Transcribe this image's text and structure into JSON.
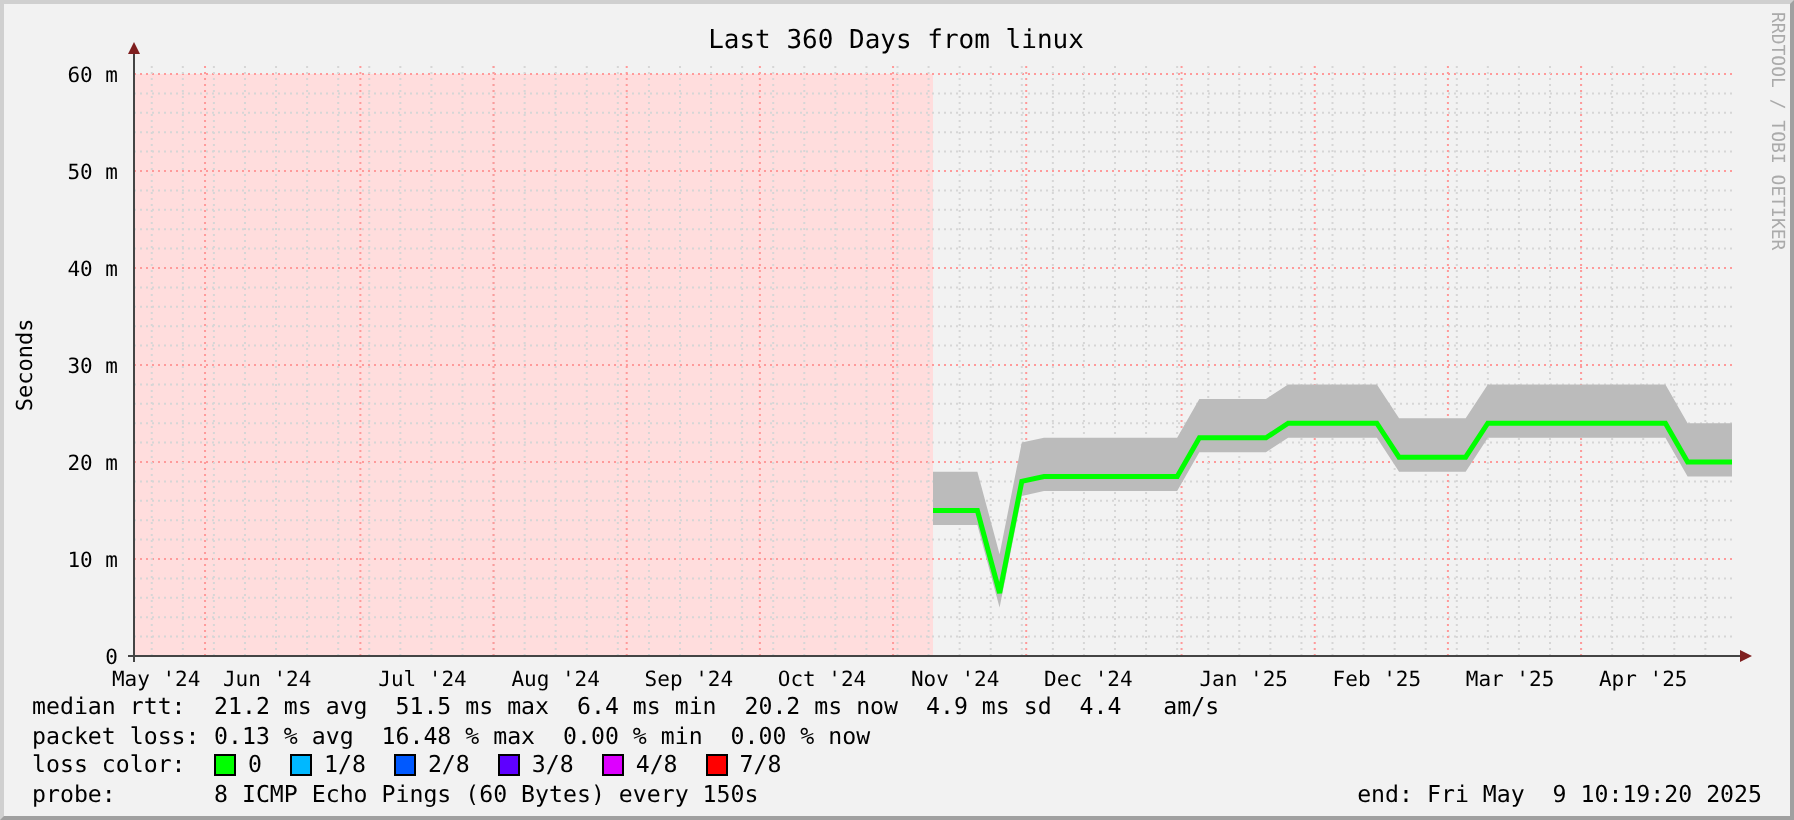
{
  "graph": {
    "watermark_text": "RRDTOOL / TOBI OETIKER",
    "chart_data": {
      "type": "line",
      "grid": true,
      "title": "Last 360 Days from linux",
      "ylabel": "Seconds",
      "ylim": [
        0,
        60
      ],
      "yticks": [
        {
          "value": 0,
          "label": "0"
        },
        {
          "value": 10,
          "label": "10 m"
        },
        {
          "value": 20,
          "label": "20 m"
        },
        {
          "value": 30,
          "label": "30 m"
        },
        {
          "value": 40,
          "label": "40 m"
        },
        {
          "value": 50,
          "label": "50 m"
        },
        {
          "value": 60,
          "label": "60 m"
        }
      ],
      "categories": [
        null,
        "May '24",
        null,
        null,
        null,
        null,
        "Jun '24",
        null,
        null,
        null,
        null,
        null,
        null,
        "Jul '24",
        null,
        null,
        null,
        null,
        null,
        "Aug '24",
        null,
        null,
        null,
        null,
        null,
        "Sep '24",
        null,
        null,
        null,
        null,
        null,
        "Oct '24",
        null,
        null,
        null,
        null,
        null,
        "Nov '24",
        null,
        null,
        null,
        null,
        null,
        "Dec '24",
        null,
        null,
        null,
        null,
        null,
        null,
        "Jan '25",
        null,
        null,
        null,
        null,
        null,
        "Feb '25",
        null,
        null,
        null,
        null,
        null,
        "Mar '25",
        null,
        null,
        null,
        null,
        null,
        "Apr '25",
        null,
        null,
        null,
        null
      ],
      "series": [
        {
          "color": "#00ff00",
          "values": [
            null,
            null,
            null,
            null,
            null,
            null,
            null,
            null,
            null,
            null,
            null,
            null,
            null,
            null,
            null,
            null,
            null,
            null,
            null,
            null,
            null,
            null,
            null,
            null,
            null,
            null,
            null,
            null,
            null,
            null,
            null,
            null,
            null,
            null,
            null,
            null,
            15,
            15,
            15,
            6.5,
            18,
            18.5,
            18.5,
            18.5,
            18.5,
            18.5,
            18.5,
            18.5,
            22.5,
            22.5,
            22.5,
            22.5,
            24,
            24,
            24,
            24,
            24,
            20.5,
            20.5,
            20.5,
            20.5,
            24,
            24,
            24,
            24,
            24,
            24,
            24,
            24,
            24,
            20,
            20,
            20
          ]
        }
      ]
    }
  },
  "legend": {
    "rows": [
      {
        "kind": "stats",
        "label": "median rtt:",
        "text": "21.2 ms avg  51.5 ms max  6.4 ms min  20.2 ms now  4.9 ms sd  4.4   am/s"
      },
      {
        "kind": "stats",
        "label": "packet loss:",
        "text": "0.13 % avg  16.48 % max  0.00 % min  0.00 % now"
      },
      {
        "kind": "colors",
        "label": "loss color:",
        "items": [
          {
            "label": "0",
            "color": "#00ff00"
          },
          {
            "label": "1/8",
            "color": "#00b8ff"
          },
          {
            "label": "2/8",
            "color": "#0059ff"
          },
          {
            "label": "3/8",
            "color": "#5e00ff"
          },
          {
            "label": "4/8",
            "color": "#dd00ff"
          },
          {
            "label": "7/8",
            "color": "#ff0000"
          }
        ]
      },
      {
        "kind": "probe",
        "label": "probe:",
        "text": "8 ICMP Echo Pings (60 Bytes) every 150s",
        "end": "end: Fri May  9 10:19:20 2025"
      }
    ]
  }
}
